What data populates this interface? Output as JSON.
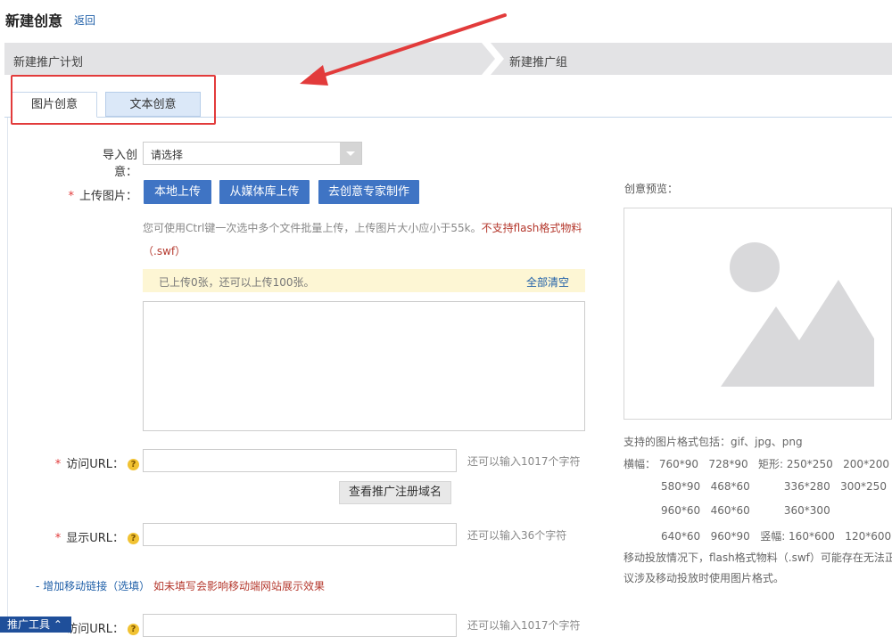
{
  "header": {
    "title": "新建创意",
    "back_label": "返回"
  },
  "steps": [
    {
      "label": "新建推广计划"
    },
    {
      "label": "新建推广组"
    }
  ],
  "tabs": [
    {
      "label": "图片创意",
      "active": true
    },
    {
      "label": "文本创意",
      "active": false
    }
  ],
  "form": {
    "import": {
      "label": "导入创意：",
      "value": "请选择"
    },
    "upload": {
      "label": "上传图片：",
      "buttons": [
        "本地上传",
        "从媒体库上传",
        "去创意专家制作"
      ],
      "hint": "您可使用Ctrl键一次选中多个文件批量上传，上传图片大小应小于55k。",
      "hint_warning": "不支持flash格式物料",
      "hint_warning_tail": "（.swf）",
      "notice": "已上传0张，还可以上传100张。",
      "clear_all": "全部清空"
    },
    "visit_url": {
      "label": "访问URL：",
      "value": "",
      "remaining": "还可以输入1017个字符"
    },
    "domain_button": "查看推广注册域名",
    "display_url": {
      "label": "显示URL：",
      "value": "",
      "remaining": "还可以输入36个字符"
    },
    "mobile_link": {
      "text": "- 增加移动链接（选填）",
      "warning": "如未填写会影响移动端网站展示效果"
    },
    "mobile_visit_url": {
      "label": "访问URL：",
      "value": "",
      "remaining": "还可以输入1017个字符"
    }
  },
  "preview": {
    "label": "创意预览：",
    "formats": "支持的图片格式包括：gif、jpg、png",
    "size_lines": [
      "横幅： 760*90   728*90   矩形: 250*250   200*200",
      "           580*90   468*60          336*280   300*250",
      "           960*60   460*60          360*300",
      "           640*60   960*90   竖幅: 160*600   120*600"
    ],
    "note_lines": [
      "移动投放情况下，flash格式物料（.swf）可能存在无法正常",
      "议涉及移动投放时使用图片格式。"
    ]
  },
  "toolbar": {
    "label": "推广工具 ⌃"
  },
  "colors": {
    "accent": "#3f74c4",
    "annotation": "#e23b3b",
    "warning": "#b5392e",
    "link": "#1f5fa8"
  }
}
